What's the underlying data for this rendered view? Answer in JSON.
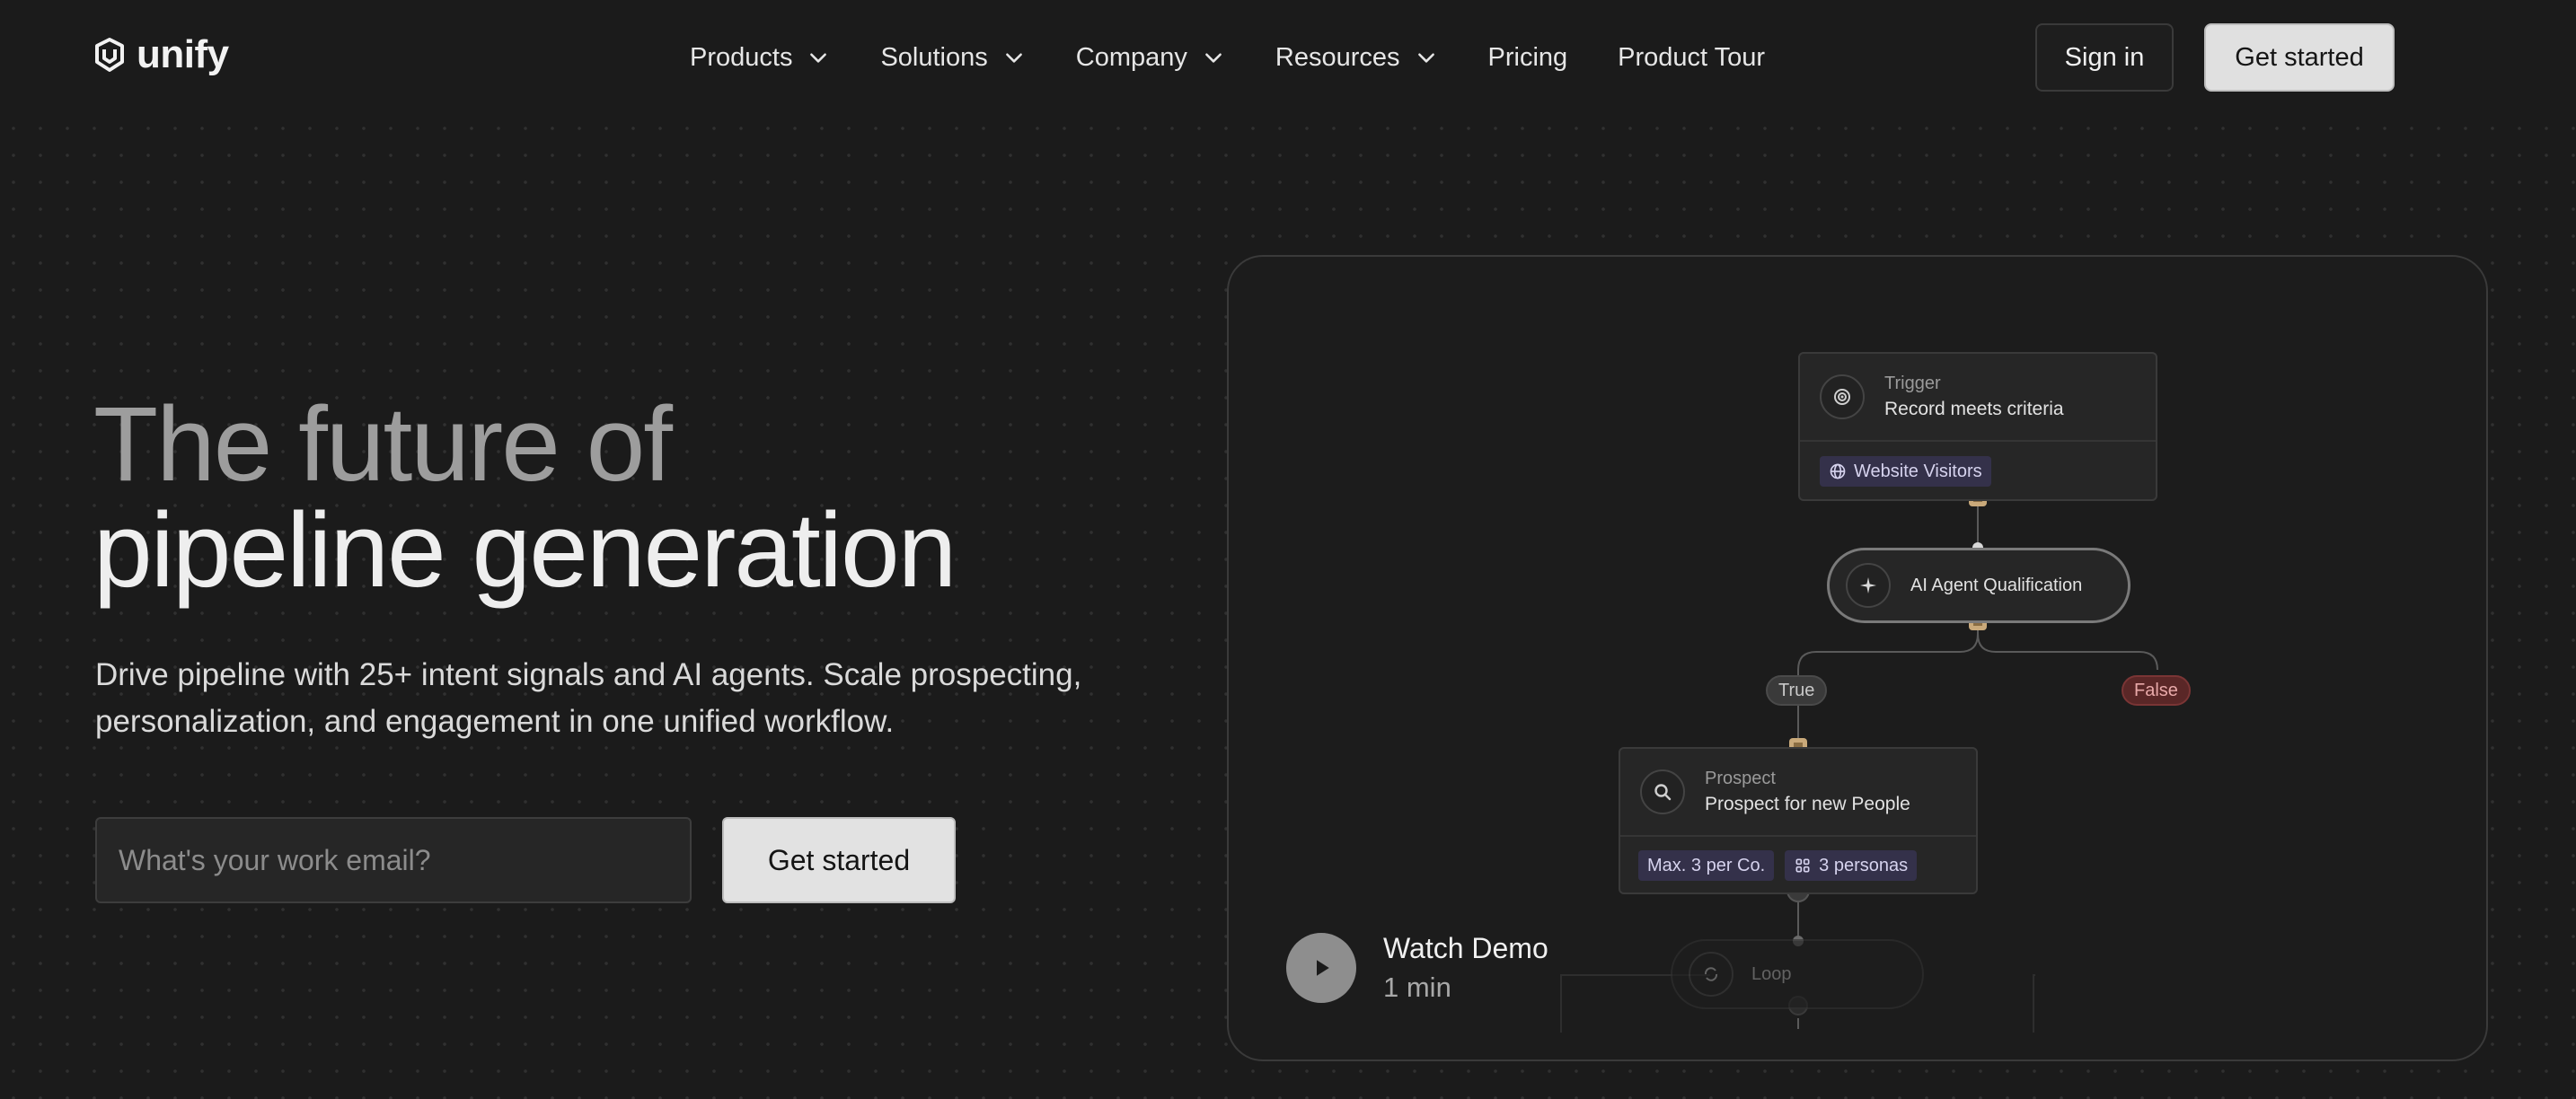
{
  "brand": {
    "name": "unify"
  },
  "nav": {
    "items": [
      {
        "label": "Products",
        "dropdown": true
      },
      {
        "label": "Solutions",
        "dropdown": true
      },
      {
        "label": "Company",
        "dropdown": true
      },
      {
        "label": "Resources",
        "dropdown": true
      },
      {
        "label": "Pricing",
        "dropdown": false
      },
      {
        "label": "Product Tour",
        "dropdown": false
      }
    ],
    "sign_in": "Sign in",
    "get_started": "Get started"
  },
  "hero": {
    "title_line1": "The future of",
    "title_line2": "pipeline generation",
    "subtitle": "Drive pipeline with 25+ intent signals and AI agents. Scale prospecting, personalization, and engagement in one unified workflow.",
    "email_placeholder": "What's your work email?",
    "cta": "Get started"
  },
  "workflow": {
    "trigger": {
      "label": "Trigger",
      "value": "Record meets criteria",
      "tag": "Website Visitors"
    },
    "agent": {
      "label": "AI Agent Qualification"
    },
    "branch_true": "True",
    "branch_false": "False",
    "prospect": {
      "label": "Prospect",
      "value": "Prospect for new People",
      "tags": [
        "Max. 3 per Co.",
        "3 personas"
      ]
    },
    "loop": {
      "label": "Loop"
    }
  },
  "demo": {
    "title": "Watch Demo",
    "duration": "1 min"
  },
  "colors": {
    "background": "#1b1b1b",
    "accent_tag": "#34314a",
    "true_tag": "#3a3a3a",
    "false_tag": "#5a2727",
    "connector_dot": "#c9a97a"
  },
  "icons": [
    "shield-logo-icon",
    "chevron-down-icon",
    "target-icon",
    "globe-icon",
    "sparkle-icon",
    "search-icon",
    "grid-icon",
    "people-icon",
    "loop-icon",
    "play-icon"
  ]
}
